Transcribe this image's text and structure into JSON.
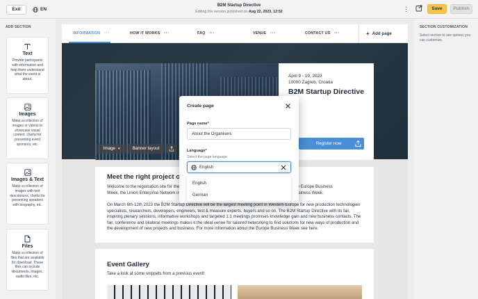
{
  "topbar": {
    "exit_label": "Exit",
    "lang_label": "EN",
    "doc_title": "B2M Startup Directive",
    "doc_subtitle_prefix": "Editing the version published on",
    "doc_subtitle_date": "Aug 22, 2023, 12:52",
    "save_label": "Save",
    "publish_label": "Publish"
  },
  "left_panel": {
    "title": "ADD SECTION",
    "sections": [
      {
        "name": "Text",
        "icon": "text-icon",
        "description": "Provide participants with information and help them understand what the event is about."
      },
      {
        "name": "Images",
        "icon": "image-icon",
        "description": "Make a collection of images or videos to showcase visual content. Useful for presenting event sponsors, etc."
      },
      {
        "name": "Images & Text",
        "icon": "image-icon",
        "description": "Make a collection of images with text descriptions. Useful for presenting speakers with biography, etc."
      },
      {
        "name": "Files",
        "icon": "file-icon",
        "description": "Make a collection of files that are available for download. These files can include documents, images, audio files, etc."
      }
    ]
  },
  "right_panel": {
    "title": "SECTION CUSTOMIZATION",
    "description": "Select section to see options you can customize."
  },
  "nav": {
    "items": [
      {
        "label": "INFORMATION",
        "active": true
      },
      {
        "label": "HOW IT WORKS",
        "active": false
      },
      {
        "label": "FAQ",
        "active": false
      },
      {
        "label": "VENUE",
        "active": false
      },
      {
        "label": "CONTACT US",
        "active": false
      }
    ],
    "add_page_label": "Add page"
  },
  "hero": {
    "date": "April 9 - 19, 2023",
    "city": "10000 Zagreb, Croatia",
    "title": "B2M Startup Directive",
    "register_label": "Register now",
    "image_btn_label": "Image",
    "banner_layout_label": "Banner layout"
  },
  "content": {
    "heading": "Meet the right project or",
    "p1_start": "Welcome to the registration site for the",
    "p1_end": "organiser of the Europe Business",
    "p1_line2_start": "Week, the Union Enterprise Network in",
    "p1_line2_end": "ope Business Week.",
    "p2_line1_start": "On March 6th-12th 2023 the B2M Startup Directive will be the largest meeting point in Western Europe for new production technologies",
    "p2_line2": "specialists, researchers, developers, engineers, test & measure experts, buyers and so on. The B2M Startup Directive with its fair,",
    "p2_line3": "inspiring plenary sessions, informative workshops and targeted 1:1 meetings promises knowledge gain and new business contacts. The",
    "p2_line4": "fair, conference and bilateral meetings makes it the ideal venue for tailored networking to find solutions for new ways of production and",
    "p2_line5": "the development of new projects and business. For more information about the Europe Business Week see here."
  },
  "gallery": {
    "heading": "Event Gallery",
    "subtitle": "Take a look at some snippets from a previous event!"
  },
  "modal": {
    "title": "Create page",
    "page_name_label": "Page name*",
    "page_name_value": "About the Organisers",
    "language_label": "Language*",
    "language_help": "Select the page language.",
    "language_value": "English",
    "options": [
      "English",
      "German"
    ]
  },
  "colors": {
    "accent": "#4a8fd6",
    "save": "#f8c34a"
  }
}
